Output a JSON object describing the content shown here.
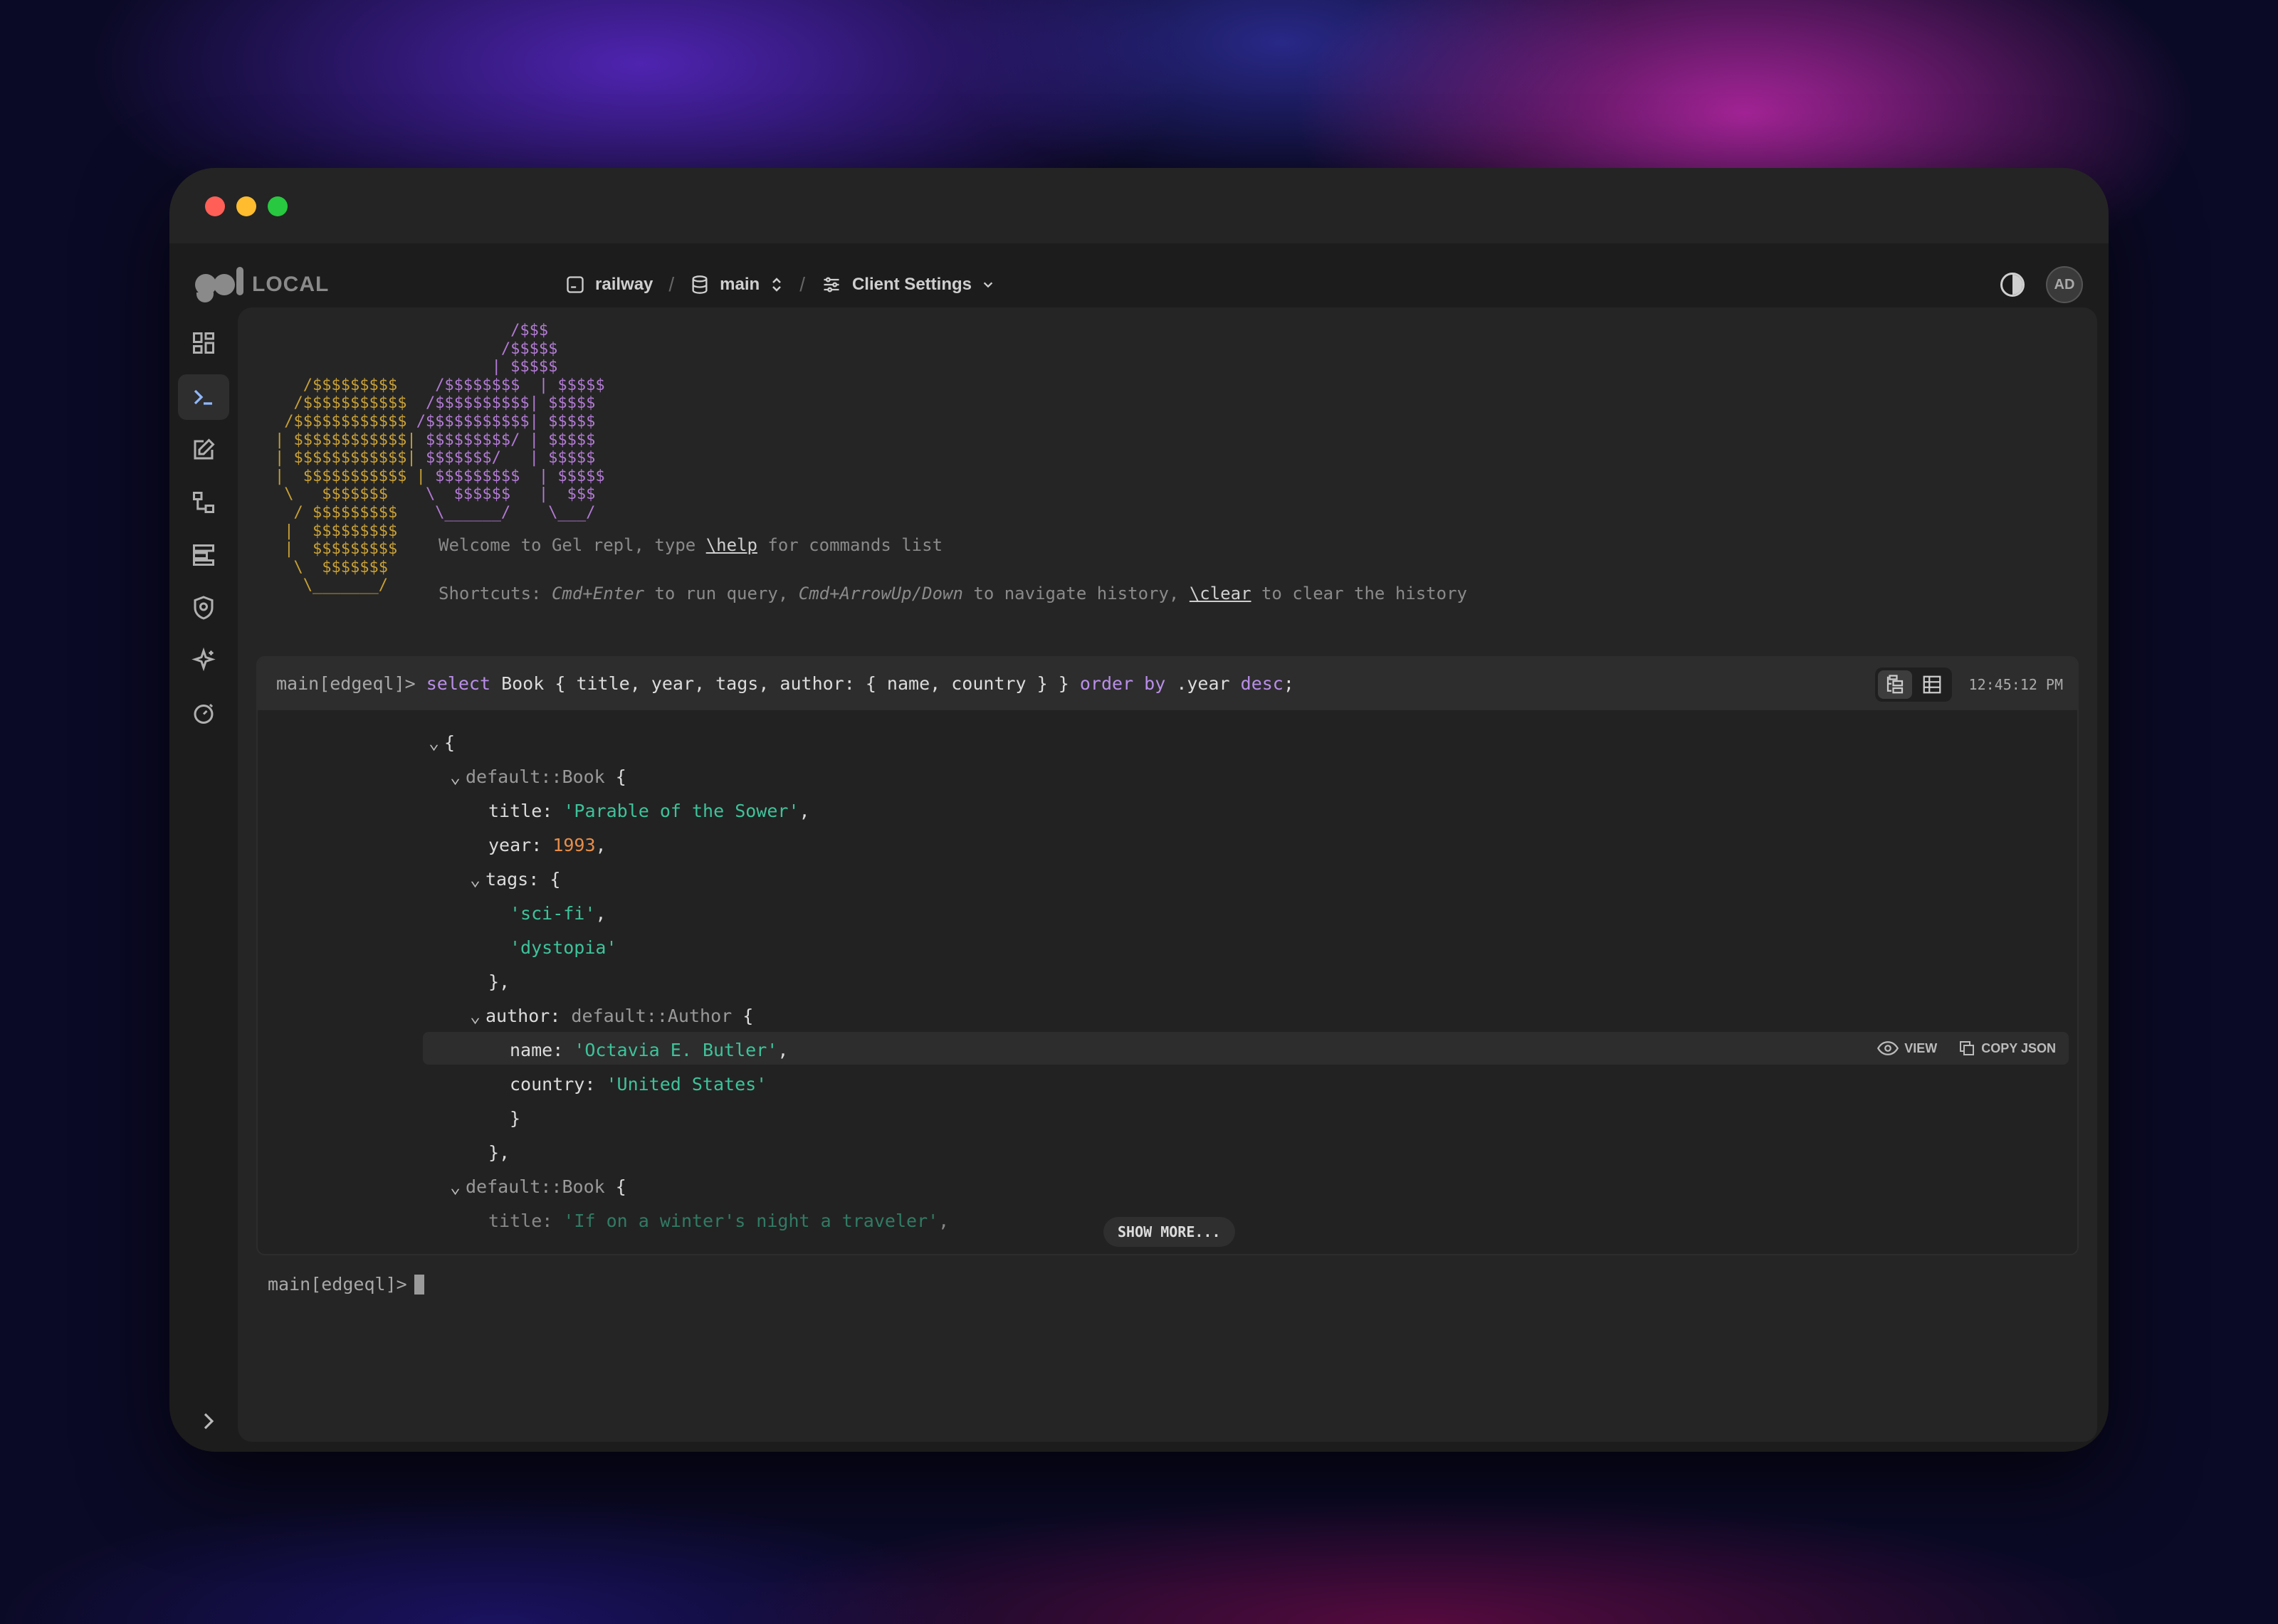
{
  "app": {
    "brand": "LOCAL",
    "breadcrumb": {
      "instance": "railway",
      "branch": "main",
      "settings": "Client Settings"
    },
    "avatar_initials": "AD"
  },
  "sidebar": {
    "items": [
      {
        "name": "dashboard",
        "icon": "grid-icon"
      },
      {
        "name": "repl",
        "icon": "terminal-icon",
        "active": true
      },
      {
        "name": "editor",
        "icon": "edit-icon"
      },
      {
        "name": "schema",
        "icon": "schema-icon"
      },
      {
        "name": "data",
        "icon": "data-icon"
      },
      {
        "name": "auth",
        "icon": "shield-icon"
      },
      {
        "name": "ai",
        "icon": "sparkle-icon"
      },
      {
        "name": "perf",
        "icon": "stopwatch-icon"
      }
    ]
  },
  "repl": {
    "welcome_prefix": "Welcome to Gel repl, type ",
    "welcome_help": "\\help",
    "welcome_suffix": " for commands list",
    "shortcuts": {
      "p1": "Shortcuts: ",
      "k1": "Cmd+Enter",
      "p2": " to run query, ",
      "k2": "Cmd+ArrowUp/Down",
      "p3": " to navigate history, ",
      "k3": "\\clear",
      "p4": " to clear the history"
    },
    "query": {
      "prompt": "main[edgeql]> ",
      "kw_select": "select",
      "part1": " Book { title, year, tags, author: { name, country } } ",
      "kw_order": "order by",
      "part2": " .year ",
      "kw_desc": "desc",
      "part3": ";",
      "time": "12:45:12 PM"
    },
    "result": {
      "open": "{",
      "book_type": "default::Book",
      "title_key": "title",
      "title_val": "'Parable of the Sower'",
      "year_key": "year",
      "year_val": "1993",
      "tags_key": "tags",
      "tags": [
        "'sci-fi'",
        "'dystopia'"
      ],
      "author_key": "author",
      "author_type": "default::Author",
      "name_key": "name",
      "name_val": "'Octavia E. Butler'",
      "country_key": "country",
      "country_val": "'United States'",
      "book2_type": "default::Book",
      "title2_val": "'If on a winter's night a traveler'",
      "view_label": "VIEW",
      "copy_label": "COPY JSON",
      "show_more": "SHOW MORE..."
    },
    "input_prompt": "main[edgeql]>"
  }
}
